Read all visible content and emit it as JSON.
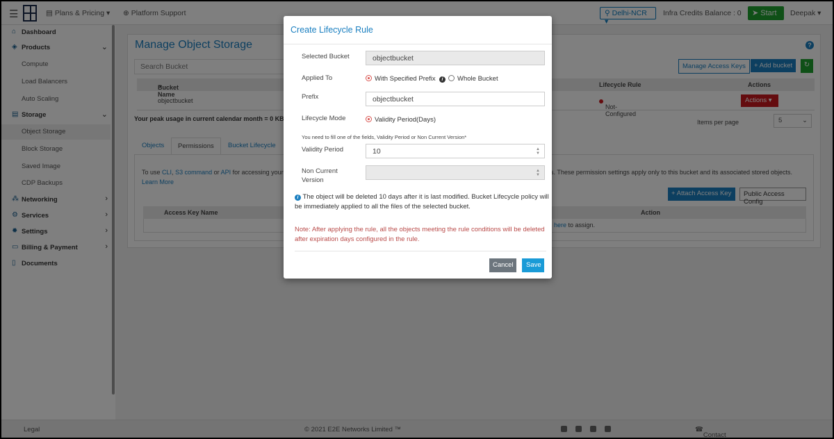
{
  "topbar": {
    "plans_label": "Plans & Pricing",
    "support_label": "Platform Support",
    "region": "Delhi-NCR",
    "credits": "Infra Credits Balance : 0",
    "start_label": "Start",
    "user": "Deepak"
  },
  "sidebar": {
    "items": [
      {
        "label": "Dashboard"
      },
      {
        "label": "Products"
      },
      {
        "label": "Compute"
      },
      {
        "label": "Load Balancers"
      },
      {
        "label": "Auto Scaling"
      },
      {
        "label": "Storage"
      },
      {
        "label": "Object Storage"
      },
      {
        "label": "Block Storage"
      },
      {
        "label": "Saved Image"
      },
      {
        "label": "CDP Backups"
      },
      {
        "label": "Networking"
      },
      {
        "label": "Services"
      },
      {
        "label": "Settings"
      },
      {
        "label": "Billing & Payment"
      },
      {
        "label": "Documents"
      }
    ]
  },
  "main": {
    "title": "Manage Object Storage",
    "search_placeholder": "Search Bucket",
    "manage_keys_label": "Manage Access Keys",
    "add_bucket_label": "+ Add bucket",
    "table": {
      "headers": [
        "Bucket Name",
        "Lifecycle Rule",
        "Actions"
      ],
      "row": {
        "name": "objectbucket",
        "lifecycle": "Not-Configured",
        "actions": "Actions"
      }
    },
    "usage": "Your peak usage in current calendar month = 0 KB",
    "items_per_page_label": "Items per page",
    "items_per_page_value": "5",
    "tabs": [
      "Objects",
      "Permissions",
      "Bucket Lifecycle"
    ],
    "perm_text": {
      "p1": "To use ",
      "cli": "CLI",
      "sep1": ", ",
      "s3": "S3 command",
      "sep2": " or ",
      "api": "API",
      "p2": " for accessing your",
      "p3": "s. These permission settings apply only to this bucket and its associated stored objects.",
      "learn": "Learn More"
    },
    "attach_label": "+ Attach Access Key",
    "public_label": "Public Access Config",
    "ak_headers": [
      "Access Key Name",
      "Action"
    ],
    "ak_assign_link": "here",
    "ak_assign_text": " to assign."
  },
  "footer": {
    "legal": "Legal",
    "copyright": "© 2021 E2E Networks Limited ™",
    "contact": "Contact Us"
  },
  "modal": {
    "title": "Create Lifecycle Rule",
    "selected_bucket_label": "Selected Bucket",
    "selected_bucket_value": "objectbucket",
    "applied_to_label": "Applied To",
    "opt_prefix": "With Specified Prefix",
    "opt_whole": "Whole Bucket",
    "prefix_label": "Prefix",
    "prefix_value": "objectbucket",
    "mode_label": "Lifecycle Mode",
    "mode_value": "Validity Period(Days)",
    "hint": "You need to fill one of the fields, Validity Period or Non Current Version*",
    "validity_label": "Validity Period",
    "validity_value": "10",
    "noncurrent_label_1": "Non Current",
    "noncurrent_label_2": "Version",
    "info": "The object will be deleted 10 days after it is last modified. Bucket Lifecycle policy will be immediately applied to all the files of the selected bucket.",
    "note": "Note: After applying the rule, all the objects meeting the rule conditions will be deleted after expiration days configured in the rule.",
    "cancel_label": "Cancel",
    "save_label": "Save"
  }
}
